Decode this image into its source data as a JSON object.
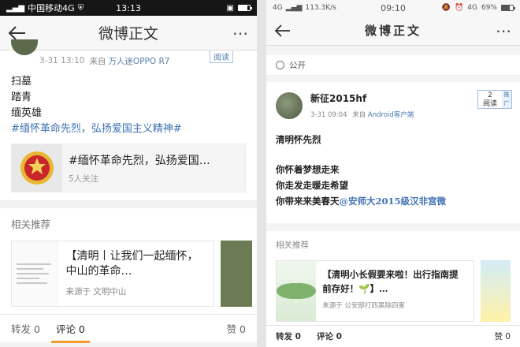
{
  "left": {
    "status": {
      "carrier": "中国移动4G",
      "time": "13:13"
    },
    "nav": {
      "title": "微博正文"
    },
    "post": {
      "time": "3-31 13:10",
      "source_prefix": "来自",
      "source": "万人迷OPPO R7",
      "read_label": "阅读",
      "lines": [
        "扫墓",
        "踏青",
        "缅英雄"
      ],
      "hashtag": "#缅怀革命先烈，弘扬爱国主义精神#"
    },
    "topic": {
      "title": "#缅怀革命先烈，弘扬爱国…",
      "followers": "5人关注"
    },
    "related": {
      "heading": "相关推荐",
      "card": {
        "title": "【清明丨让我们一起缅怀，中山的革命…",
        "source": "来源于 文明中山"
      }
    },
    "actions": {
      "repost": "转发 0",
      "comment": "评论 0",
      "like": "赞 0"
    },
    "colors": {
      "accent": "#f39c2a",
      "link": "#3f72b4"
    }
  },
  "right": {
    "status": {
      "network": "4G",
      "speed": "113.3K/s",
      "time": "09:10",
      "network2": "4G",
      "battery": "69%"
    },
    "nav": {
      "title": "微博正文"
    },
    "visibility": "公开",
    "post": {
      "username": "新征2015hf",
      "time": "3-31 09:04",
      "source_prefix": "来自",
      "source": "Android客户端",
      "read_count": "2",
      "read_label": "阅读",
      "push_label": "推广",
      "line1": "清明怀先烈",
      "line2": "你怀着梦想走来",
      "line3": "你走发走暖走希望",
      "line4": "你带来来美春天",
      "mention": "@安师大2015级汉非宫微"
    },
    "related": {
      "heading": "相关推荐",
      "card": {
        "title": "【清明小长假要来啦！出行指南提前存好！🌱】…",
        "source": "来源于 公安部打四黑除四害"
      }
    },
    "actions": {
      "repost": "转发 0",
      "comment": "评论 0",
      "like": "赞 0"
    }
  }
}
